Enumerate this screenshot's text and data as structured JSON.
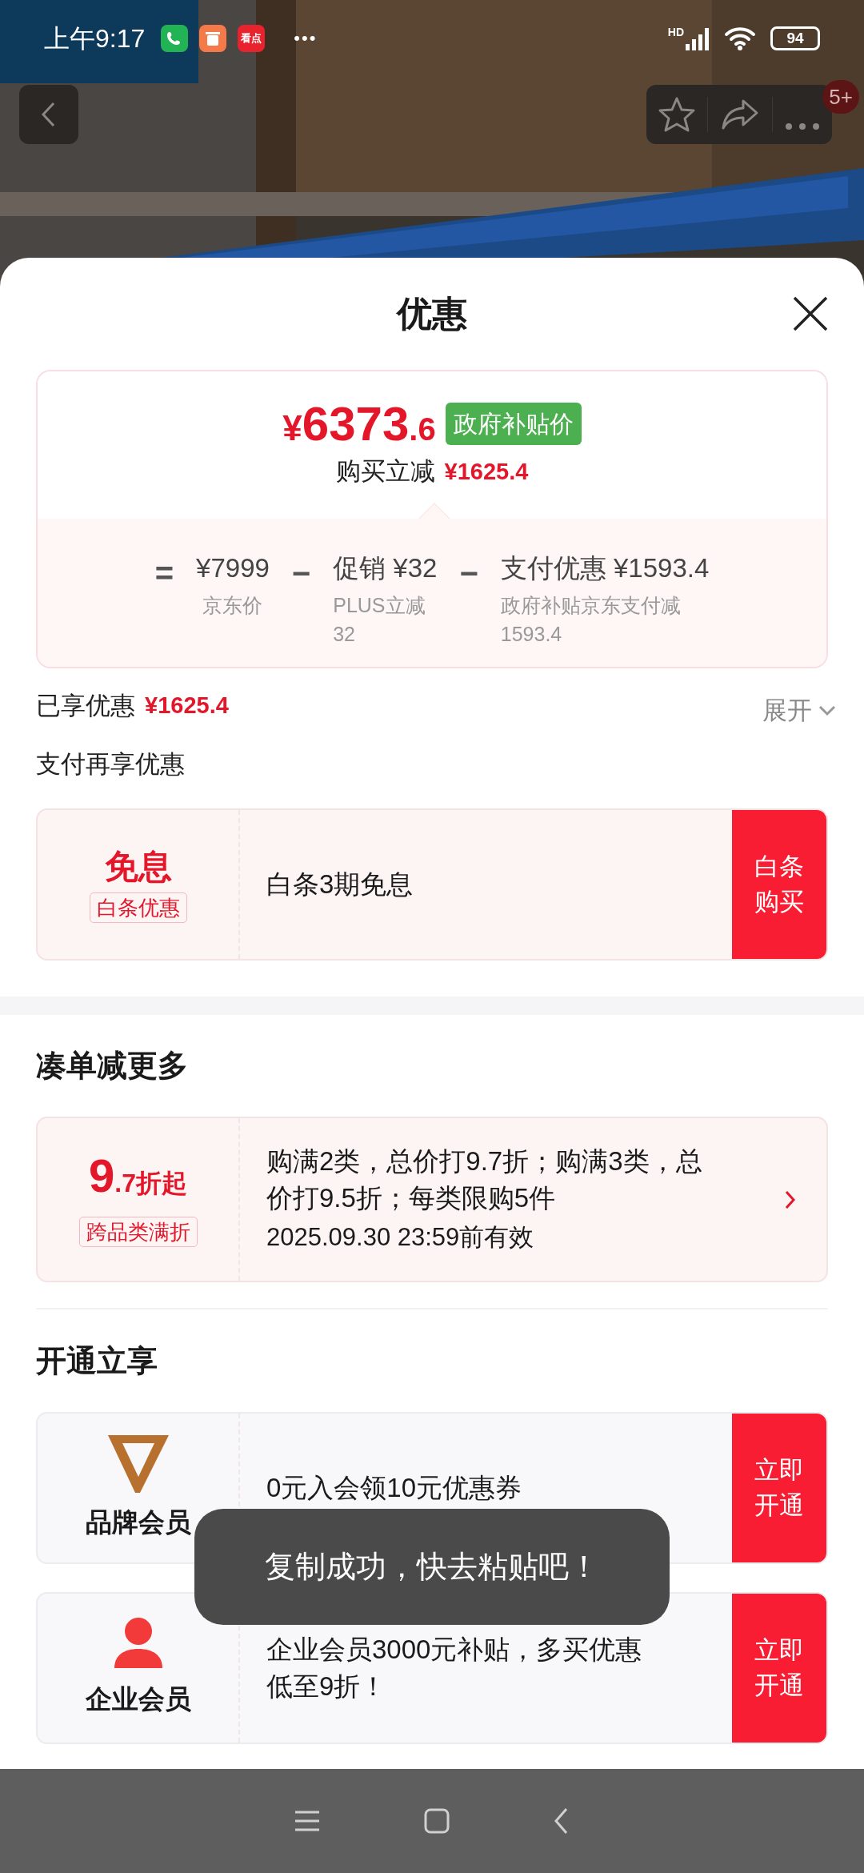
{
  "status_bar": {
    "time": "上午9:17",
    "notifications": [
      {
        "kind": "phone"
      },
      {
        "kind": "trash"
      },
      {
        "kind": "app",
        "label": "看点"
      }
    ],
    "more": "•••",
    "network": "HD",
    "battery": "94"
  },
  "header": {
    "badge": "5+"
  },
  "sheet": {
    "title": "优惠",
    "price": {
      "symbol": "¥",
      "integer": "6373",
      "decimal": ".6",
      "tag": "政府补贴价",
      "subtitle": "购买立减",
      "subtitle_amount": "¥1625.4"
    },
    "breakdown": [
      {
        "operator": "=",
        "title": "¥7999",
        "caption": [
          "京东价"
        ]
      },
      {
        "operator": "−",
        "title": "促销 ¥32",
        "caption": [
          "PLUS立减",
          "32"
        ]
      },
      {
        "operator": "−",
        "title": "支付优惠 ¥1593.4",
        "caption": [
          "政府补贴京东支付减",
          "1593.4"
        ]
      }
    ],
    "enjoyed": {
      "label": "已享优惠",
      "amount": "¥1625.4",
      "toggle": "展开",
      "expanded": false
    },
    "sections": [
      {
        "heading": "支付再享优惠",
        "kind": "payment",
        "offers": [
          {
            "kind": "badge",
            "title": "免息",
            "tag": "白条优惠",
            "text": [
              "白条3期免息"
            ],
            "action": [
              "白条",
              "购买"
            ]
          }
        ]
      },
      {
        "heading": "凑单减更多",
        "kind": "bundle",
        "offers": [
          {
            "kind": "discount",
            "big": "9",
            "small": ".7折起",
            "tag": "跨品类满折",
            "text": [
              "购满2类，总价打9.7折；购满3类，总",
              "价打9.5折；每类限购5件"
            ],
            "validity": "2025.09.30 23:59前有效"
          }
        ]
      },
      {
        "heading": "开通立享",
        "kind": "membership",
        "offers": [
          {
            "kind": "brand",
            "title": "品牌会员",
            "text": [
              "0元入会领10元优惠券"
            ],
            "action": [
              "立即",
              "开通"
            ]
          },
          {
            "kind": "person",
            "title": "企业会员",
            "text": [
              "企业会员3000元补贴，多买优惠",
              "低至9折！"
            ],
            "action": [
              "立即",
              "开通"
            ]
          }
        ]
      }
    ]
  },
  "toast": "复制成功，快去粘贴吧！"
}
